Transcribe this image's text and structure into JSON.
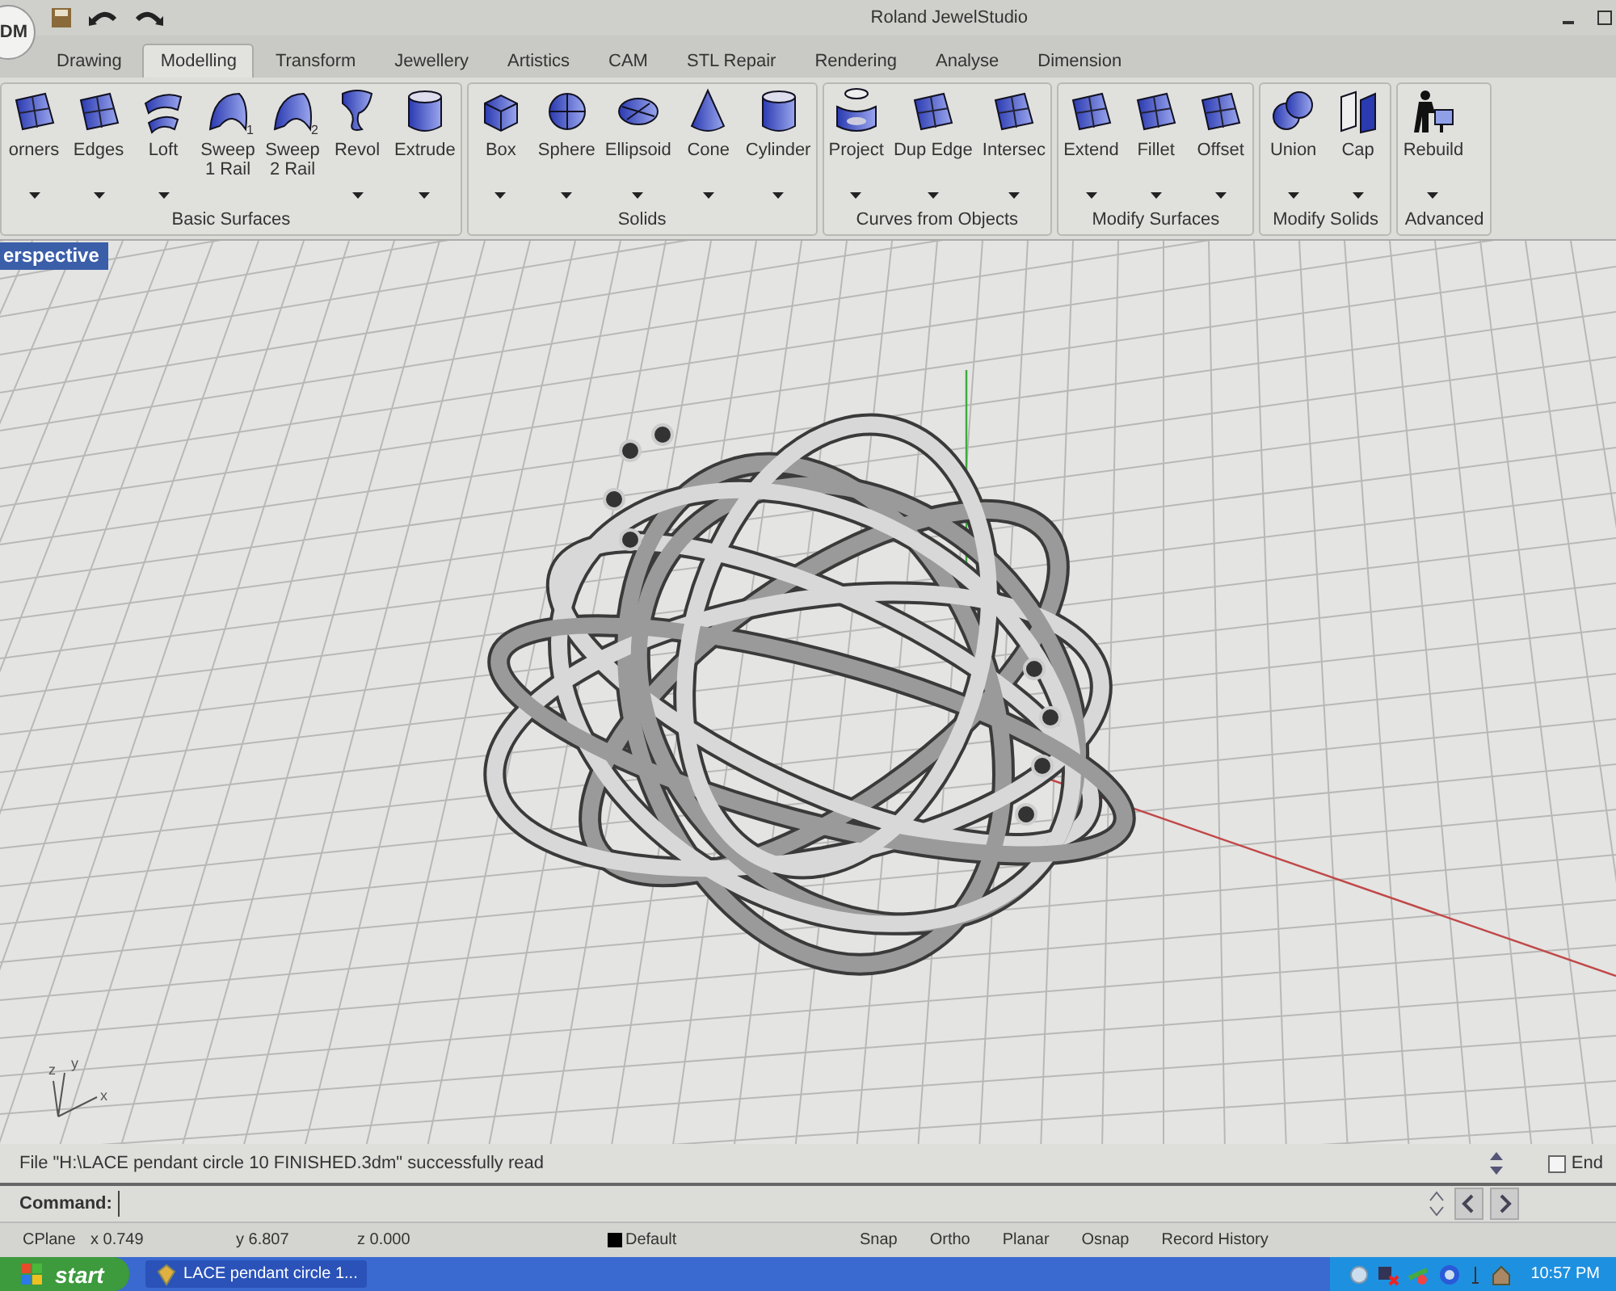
{
  "app_button": {
    "label": "DM"
  },
  "window": {
    "title": "Roland JewelStudio"
  },
  "tabs": [
    {
      "label": "Drawing",
      "selected": false
    },
    {
      "label": "Modelling",
      "selected": true
    },
    {
      "label": "Transform",
      "selected": false
    },
    {
      "label": "Jewellery",
      "selected": false
    },
    {
      "label": "Artistics",
      "selected": false
    },
    {
      "label": "CAM",
      "selected": false
    },
    {
      "label": "STL Repair",
      "selected": false
    },
    {
      "label": "Rendering",
      "selected": false
    },
    {
      "label": "Analyse",
      "selected": false
    },
    {
      "label": "Dimension",
      "selected": false
    }
  ],
  "ribbon_groups": [
    {
      "title": "Basic Surfaces",
      "tools": [
        {
          "label": "orners",
          "dropdown": true
        },
        {
          "label": "Edges",
          "dropdown": true
        },
        {
          "label": "Loft",
          "dropdown": true
        },
        {
          "label": "Sweep 1 Rail",
          "dropdown": false,
          "badge": "1"
        },
        {
          "label": "Sweep 2 Rail",
          "dropdown": false,
          "badge": "2"
        },
        {
          "label": "Revol",
          "dropdown": true
        },
        {
          "label": "Extrude",
          "dropdown": true
        }
      ]
    },
    {
      "title": "Solids",
      "tools": [
        {
          "label": "Box",
          "dropdown": true
        },
        {
          "label": "Sphere",
          "dropdown": true
        },
        {
          "label": "Ellipsoid",
          "dropdown": true
        },
        {
          "label": "Cone",
          "dropdown": true
        },
        {
          "label": "Cylinder",
          "dropdown": true
        }
      ]
    },
    {
      "title": "Curves from Objects",
      "tools": [
        {
          "label": "Project",
          "dropdown": true
        },
        {
          "label": "Dup Edge",
          "dropdown": true
        },
        {
          "label": "Intersec",
          "dropdown": true
        }
      ]
    },
    {
      "title": "Modify Surfaces",
      "tools": [
        {
          "label": "Extend",
          "dropdown": true
        },
        {
          "label": "Fillet",
          "dropdown": true
        },
        {
          "label": "Offset",
          "dropdown": true
        }
      ]
    },
    {
      "title": "Modify Solids",
      "tools": [
        {
          "label": "Union",
          "dropdown": true
        },
        {
          "label": "Cap",
          "dropdown": true
        }
      ]
    },
    {
      "title": "Advanced",
      "tools": [
        {
          "label": "Rebuild",
          "dropdown": true
        }
      ]
    }
  ],
  "viewport": {
    "title": "erspective",
    "axis_labels": [
      "z",
      "y",
      "x"
    ]
  },
  "message": "File \"H:\\LACE pendant circle 10 FINISHED.3dm\" successfully read",
  "end_checkbox": {
    "label": "End",
    "checked": false
  },
  "command": {
    "label": "Command:"
  },
  "status_bar": {
    "cplane": "CPlane",
    "x": "x 0.749",
    "y": "y 6.807",
    "z": "z 0.000",
    "layer": {
      "label": "Default",
      "color": "#000000"
    },
    "toggles": [
      "Snap",
      "Ortho",
      "Planar",
      "Osnap",
      "Record History"
    ]
  },
  "taskbar": {
    "start": "start",
    "task": "LACE pendant circle 1...",
    "clock": "10:57 PM"
  }
}
